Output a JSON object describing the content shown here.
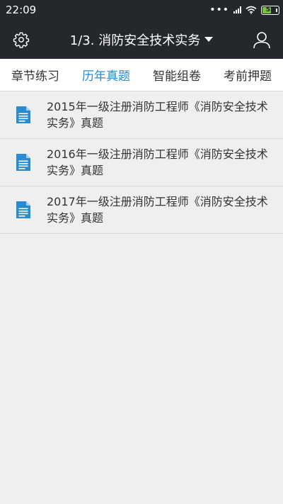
{
  "status_bar": {
    "time": "22:09",
    "dots": "•••",
    "battery_level": "52"
  },
  "header": {
    "title": "1/3. 消防安全技术实务",
    "settings_icon": "gear-icon",
    "profile_icon": "user-icon",
    "dropdown_icon": "caret-down-icon"
  },
  "tabs": [
    {
      "label": "章节练习",
      "active": false
    },
    {
      "label": "历年真题",
      "active": true
    },
    {
      "label": "智能组卷",
      "active": false
    },
    {
      "label": "考前押题",
      "active": false
    }
  ],
  "list": [
    {
      "title": "2015年一级注册消防工程师《消防安全技术实务》真题"
    },
    {
      "title": "2016年一级注册消防工程师《消防安全技术实务》真题"
    },
    {
      "title": "2017年一级注册消防工程师《消防安全技术实务》真题"
    }
  ],
  "colors": {
    "header_bg": "#24272c",
    "active_tab": "#2a8bd1",
    "doc_icon": "#2a8bd1",
    "battery_fill": "#7bc242"
  }
}
